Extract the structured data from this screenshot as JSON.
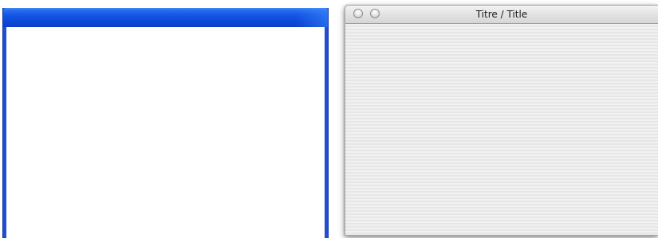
{
  "xp_window": {
    "title": ""
  },
  "mac_window": {
    "title": "Titre / Title",
    "buttons": {
      "close": "close-icon",
      "minimize": "minimize-icon"
    }
  },
  "colors": {
    "xp_titlebar": "#1757e6",
    "xp_border": "#1f4fd6",
    "mac_titlebar": "#e4e4e4",
    "mac_content": "#ededed"
  }
}
